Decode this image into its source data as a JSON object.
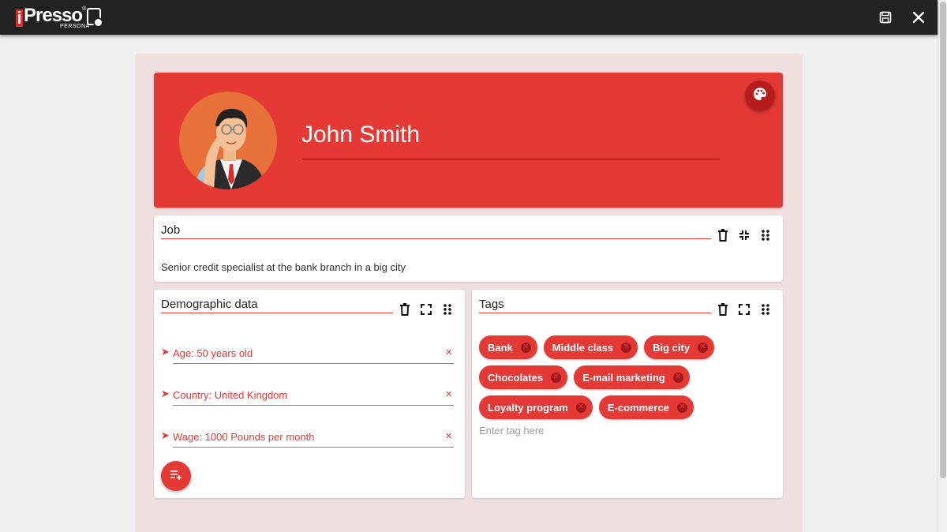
{
  "app": {
    "logo_letter": "i",
    "logo_word": "Presso",
    "logo_reg": "®",
    "logo_sub": "PERSONA",
    "save_icon": "save-icon",
    "close_icon": "close-icon"
  },
  "colors": {
    "accent": "#e53935",
    "topbar": "#222222",
    "canvas": "#efe0df"
  },
  "persona": {
    "name": "John Smith",
    "palette_icon": "palette-icon"
  },
  "job": {
    "title": "Job",
    "text": "Senior credit specialist at the bank branch in a big city",
    "tools": [
      "delete-icon",
      "collapse-icon",
      "drag-handle-icon"
    ]
  },
  "demographic": {
    "title": "Demographic data",
    "items": [
      {
        "text": "Age: 50 years old"
      },
      {
        "text": "Country: United Kingdom"
      },
      {
        "text": "Wage: 1000 Pounds per month"
      }
    ],
    "remove_glyph": "×",
    "arrow_glyph": "➤",
    "tools": [
      "delete-icon",
      "expand-icon",
      "drag-handle-icon"
    ]
  },
  "tags": {
    "title": "Tags",
    "rows": [
      [
        "Bank",
        "Middle class",
        "Big city"
      ],
      [
        "Chocolates",
        "E-mail marketing"
      ],
      [
        "Loyalty program",
        "E-commerce"
      ]
    ],
    "input_placeholder": "Enter tag here",
    "tools": [
      "delete-icon",
      "expand-icon",
      "drag-handle-icon"
    ]
  }
}
